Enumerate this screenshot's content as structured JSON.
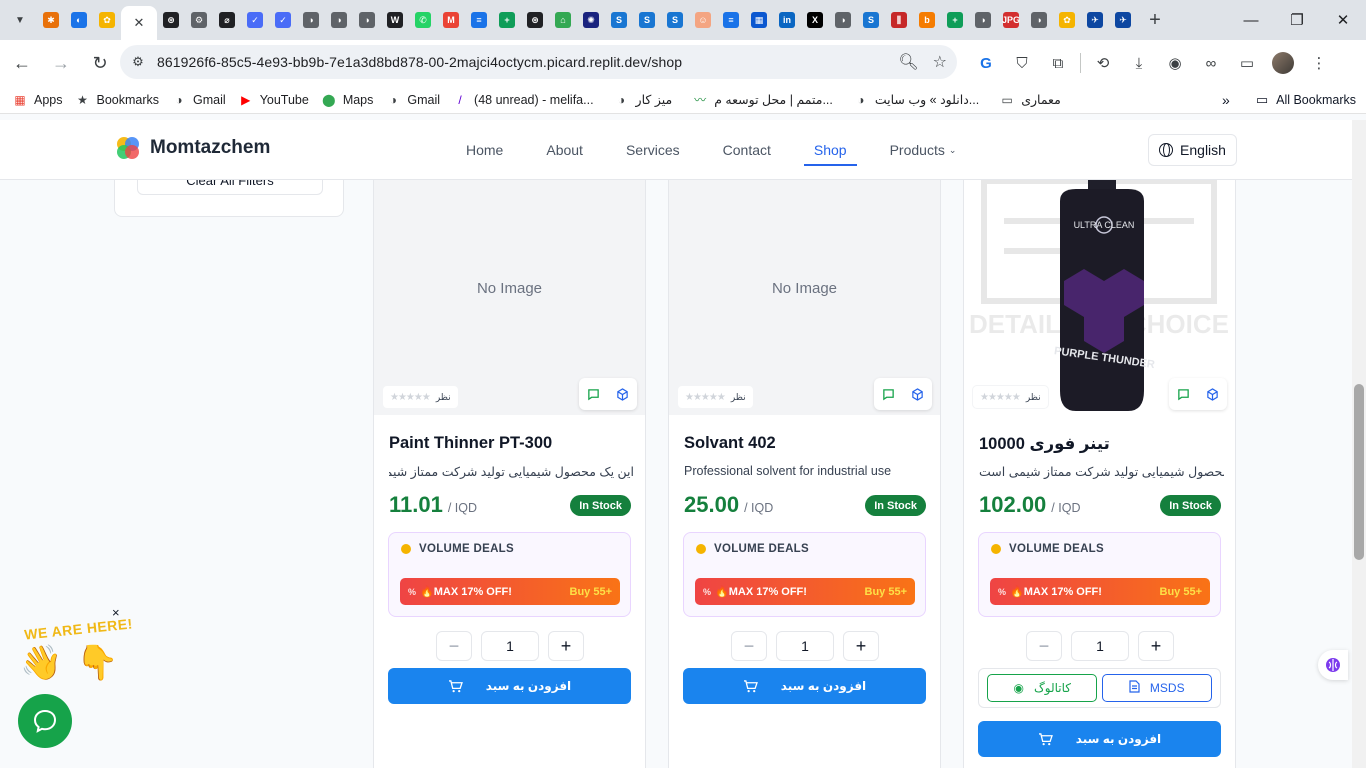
{
  "browser": {
    "tab_icons": [
      {
        "name": "tab-favicon-1",
        "color": "#e8710a",
        "glyph": "✱"
      },
      {
        "name": "tab-favicon-2",
        "color": "#1a73e8",
        "glyph": "◐"
      },
      {
        "name": "tab-favicon-3",
        "color": "#f5b400",
        "glyph": "✿"
      },
      {
        "name": "tab-favicon-5",
        "color": "#202124",
        "glyph": "⊛"
      },
      {
        "name": "tab-favicon-6",
        "color": "#5f6368",
        "glyph": "⚙"
      },
      {
        "name": "tab-favicon-7",
        "color": "#202124",
        "glyph": "⌀"
      },
      {
        "name": "tab-favicon-8",
        "color": "#4a6cf7",
        "glyph": "✓"
      },
      {
        "name": "tab-favicon-9",
        "color": "#4a6cf7",
        "glyph": "✓"
      },
      {
        "name": "tab-favicon-10",
        "color": "#5f6368",
        "glyph": "◑"
      },
      {
        "name": "tab-favicon-11",
        "color": "#5f6368",
        "glyph": "◑"
      },
      {
        "name": "tab-favicon-12",
        "color": "#5f6368",
        "glyph": "◑"
      },
      {
        "name": "tab-favicon-13",
        "color": "#202124",
        "glyph": "W"
      },
      {
        "name": "tab-favicon-14",
        "color": "#25d366",
        "glyph": "✆"
      },
      {
        "name": "tab-favicon-15",
        "color": "#ea4335",
        "glyph": "M"
      },
      {
        "name": "tab-favicon-16",
        "color": "#1a73e8",
        "glyph": "≡"
      },
      {
        "name": "tab-favicon-17",
        "color": "#0f9d58",
        "glyph": "+"
      },
      {
        "name": "tab-favicon-18",
        "color": "#202124",
        "glyph": "⊛"
      },
      {
        "name": "tab-favicon-19",
        "color": "#34a853",
        "glyph": "⌂"
      },
      {
        "name": "tab-favicon-20",
        "color": "#1a237e",
        "glyph": "✺"
      },
      {
        "name": "tab-favicon-21",
        "color": "#1976d2",
        "glyph": "S"
      },
      {
        "name": "tab-favicon-22",
        "color": "#1976d2",
        "glyph": "S"
      },
      {
        "name": "tab-favicon-23",
        "color": "#1976d2",
        "glyph": "S"
      },
      {
        "name": "tab-favicon-24",
        "color": "#f4a582",
        "glyph": "☺"
      },
      {
        "name": "tab-favicon-25",
        "color": "#1a73e8",
        "glyph": "≡"
      },
      {
        "name": "tab-favicon-26",
        "color": "#0b57d0",
        "glyph": "▦"
      },
      {
        "name": "tab-favicon-27",
        "color": "#0a66c2",
        "glyph": "in"
      },
      {
        "name": "tab-favicon-28",
        "color": "#000000",
        "glyph": "X"
      },
      {
        "name": "tab-favicon-29",
        "color": "#5f6368",
        "glyph": "◑"
      },
      {
        "name": "tab-favicon-30",
        "color": "#1976d2",
        "glyph": "S"
      },
      {
        "name": "tab-favicon-31",
        "color": "#c62828",
        "glyph": "⫼"
      },
      {
        "name": "tab-favicon-32",
        "color": "#f57c00",
        "glyph": "b"
      },
      {
        "name": "tab-favicon-33",
        "color": "#0f9d58",
        "glyph": "+"
      },
      {
        "name": "tab-favicon-34",
        "color": "#5f6368",
        "glyph": "◑"
      },
      {
        "name": "tab-favicon-35",
        "color": "#d32f2f",
        "glyph": "JPG"
      },
      {
        "name": "tab-favicon-36",
        "color": "#5f6368",
        "glyph": "◑"
      },
      {
        "name": "tab-favicon-37",
        "color": "#f5b400",
        "glyph": "✿"
      },
      {
        "name": "tab-favicon-38",
        "color": "#0d47a1",
        "glyph": "✈"
      },
      {
        "name": "tab-favicon-39",
        "color": "#0d47a1",
        "glyph": "✈"
      }
    ],
    "url": "861926f6-85c5-4e93-bb9b-7e1a3d8bd878-00-2majci4octycm.picard.replit.dev/shop",
    "bookmarks": [
      {
        "label": "Apps",
        "icon": "apps-grid-icon",
        "glyph": "▦",
        "color": "#ea4335"
      },
      {
        "label": "Bookmarks",
        "icon": "star-icon",
        "glyph": "★",
        "color": "#3c4043"
      },
      {
        "label": "Gmail",
        "icon": "globe-icon",
        "glyph": "◑",
        "color": "#3c4043"
      },
      {
        "label": "YouTube",
        "icon": "youtube-icon",
        "glyph": "▶",
        "color": "#ff0000"
      },
      {
        "label": "Maps",
        "icon": "maps-pin-icon",
        "glyph": "⬤",
        "color": "#34a853"
      },
      {
        "label": "Gmail",
        "icon": "globe-icon",
        "glyph": "◑",
        "color": "#3c4043"
      },
      {
        "label": "(48 unread) - melifa...",
        "icon": "yahoo-icon",
        "glyph": "/",
        "color": "#6001d2"
      },
      {
        "label": "میز کار",
        "icon": "globe-icon",
        "glyph": "◑",
        "color": "#3c4043"
      },
      {
        "label": "متمم | محل توسعه م...",
        "icon": "motamem-icon",
        "glyph": "〰",
        "color": "#1e8e3e"
      },
      {
        "label": "دانلود » وب سایت...",
        "icon": "globe-icon",
        "glyph": "◑",
        "color": "#3c4043"
      },
      {
        "label": "معماری",
        "icon": "folder-icon",
        "glyph": "▭",
        "color": "#3c4043"
      }
    ],
    "all_bookmarks": "All Bookmarks"
  },
  "site": {
    "brand": "Momtazchem",
    "nav": [
      {
        "label": "Home",
        "active": false
      },
      {
        "label": "About",
        "active": false
      },
      {
        "label": "Services",
        "active": false
      },
      {
        "label": "Contact",
        "active": false
      },
      {
        "label": "Shop",
        "active": true
      },
      {
        "label": "Products",
        "active": false,
        "dropdown": true
      }
    ],
    "language": "English",
    "clear_filters": "Clear All Filters"
  },
  "products": [
    {
      "name": "Paint Thinner PT-300",
      "description": "این یک محصول شیمیایی تولید شرکت ممتاز شیمی است",
      "price": "11.01",
      "currency": "/ IQD",
      "stock": "In Stock",
      "image_text": "No Image",
      "rating_label": "نظر",
      "rating_stars": "★★★★★",
      "deals_title": "VOLUME DEALS",
      "deal_text": "🔥MAX 17% OFF!",
      "deal_buy": "Buy 55+",
      "qty": "1",
      "add_to_cart": "افزودن به سبد"
    },
    {
      "name": "Solvant 402",
      "description": "Professional solvent for industrial use",
      "price": "25.00",
      "currency": "/ IQD",
      "stock": "In Stock",
      "image_text": "No Image",
      "rating_label": "نظر",
      "rating_stars": "★★★★★",
      "deals_title": "VOLUME DEALS",
      "deal_text": "🔥MAX 17% OFF!",
      "deal_buy": "Buy 55+",
      "qty": "1",
      "add_to_cart": "افزودن به سبد"
    },
    {
      "name": "تینر فوری 10000",
      "description": "این یک محصول شیمیایی تولید شرکت ممتاز شیمی است",
      "price": "102.00",
      "currency": "/ IQD",
      "stock": "In Stock",
      "image_text": "",
      "bottle_brand": "ULTRA CLEAN",
      "bottle_label": "PURPLE THUNDER",
      "watermark": "DETAILER'S CHOICE",
      "rating_label": "نظر",
      "rating_stars": "★★★★★",
      "deals_title": "VOLUME DEALS",
      "deal_text": "🔥MAX 17% OFF!",
      "deal_buy": "Buy 55+",
      "qty": "1",
      "catalog": "کاتالوگ",
      "msds": "MSDS",
      "add_to_cart": "افزودن به سبد"
    }
  ],
  "widgets": {
    "we_are_here": "WE ARE HERE!",
    "close": "×"
  },
  "colors": {
    "accent": "#2563eb",
    "price": "#15803d",
    "cart_button": "#1a84ee",
    "chat": "#16a34a"
  }
}
